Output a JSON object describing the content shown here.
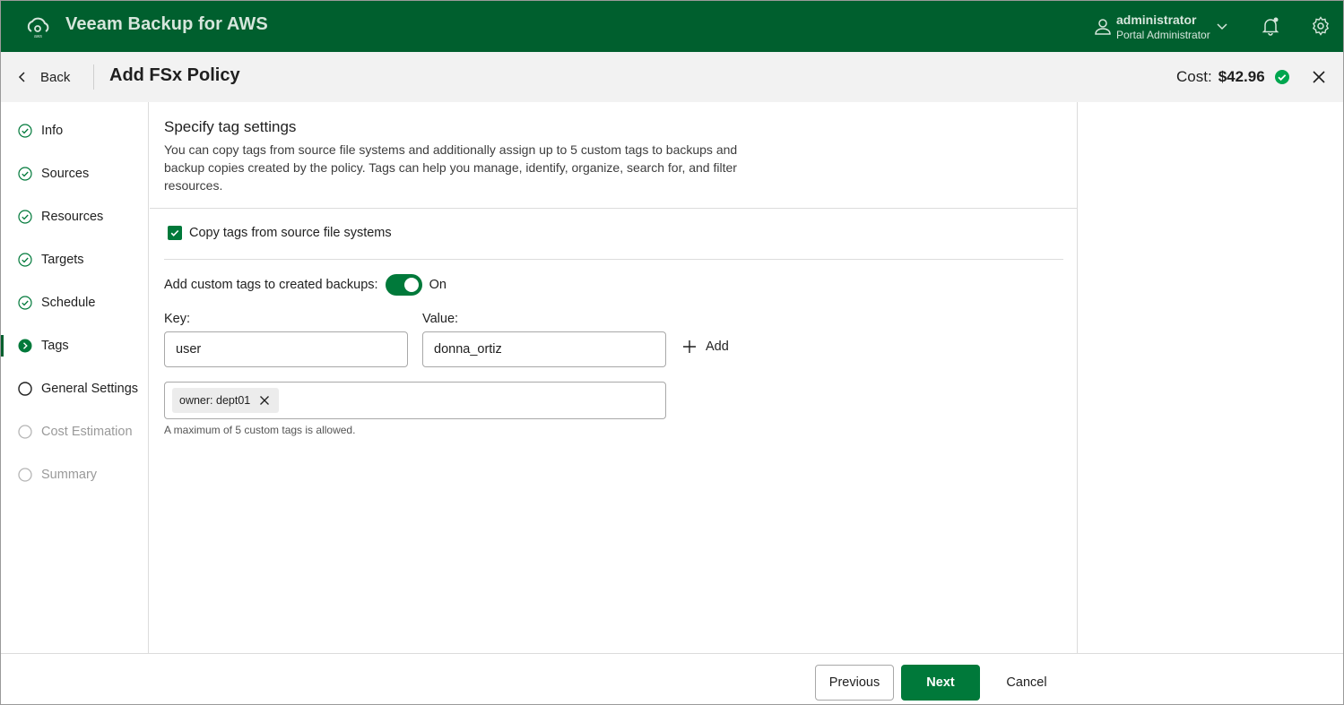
{
  "app": {
    "title": "Veeam Backup for AWS",
    "user_name": "administrator",
    "user_role": "Portal Administrator"
  },
  "header": {
    "back_label": "Back",
    "page_title": "Add FSx Policy",
    "cost_label": "Cost:",
    "cost_value": "$42.96"
  },
  "steps": [
    {
      "label": "Info",
      "state": "done"
    },
    {
      "label": "Sources",
      "state": "done"
    },
    {
      "label": "Resources",
      "state": "done"
    },
    {
      "label": "Targets",
      "state": "done"
    },
    {
      "label": "Schedule",
      "state": "done"
    },
    {
      "label": "Tags",
      "state": "current"
    },
    {
      "label": "General Settings",
      "state": "pending"
    },
    {
      "label": "Cost Estimation",
      "state": "disabled"
    },
    {
      "label": "Summary",
      "state": "disabled"
    }
  ],
  "main": {
    "section_title": "Specify tag settings",
    "section_desc": "You can copy tags from source file systems and additionally assign up to 5 custom tags to backups and backup copies created by the policy. Tags can help you manage, identify, organize, search for, and filter resources.",
    "copy_tags_label": "Copy tags from source file systems",
    "copy_tags_checked": true,
    "custom_tags_label": "Add custom tags to created backups:",
    "custom_tags_toggle": "On",
    "key_label": "Key:",
    "key_value": "user",
    "value_label": "Value:",
    "value_value": "donna_ortiz",
    "add_label": "Add",
    "tags": [
      "owner: dept01"
    ],
    "hint": "A maximum of 5 custom tags is allowed."
  },
  "footer": {
    "previous_label": "Previous",
    "next_label": "Next",
    "cancel_label": "Cancel"
  },
  "colors": {
    "brand": "#005f2e",
    "accent": "#00793a"
  }
}
